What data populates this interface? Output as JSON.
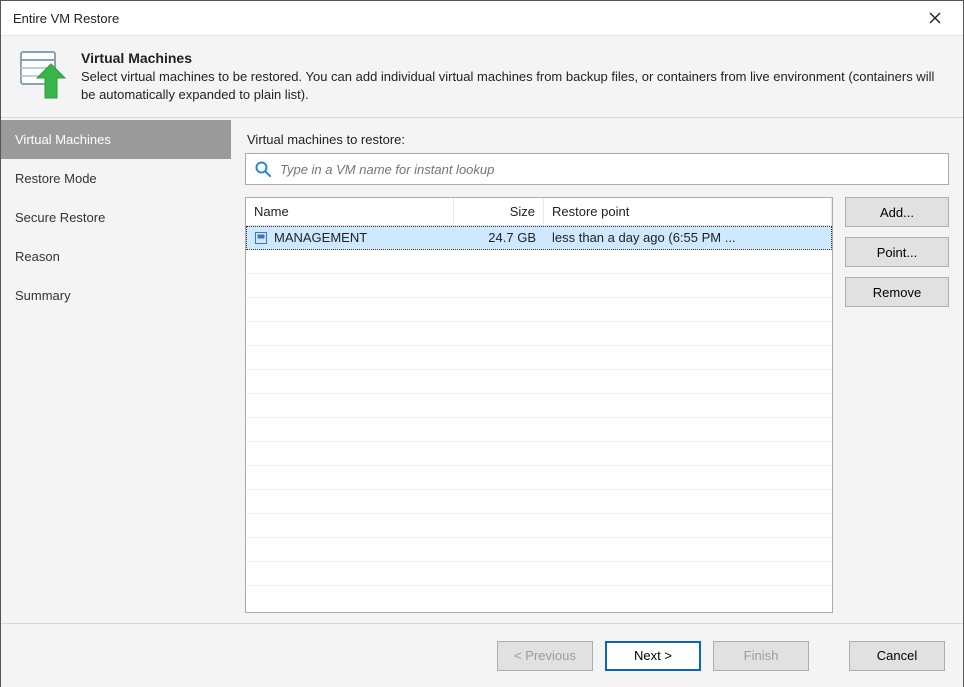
{
  "window": {
    "title": "Entire VM Restore"
  },
  "header": {
    "title": "Virtual Machines",
    "description": "Select virtual machines to be restored. You  can add individual virtual machines from backup files, or containers from live environment (containers will be automatically expanded to plain list)."
  },
  "sidenav": {
    "items": [
      {
        "label": "Virtual Machines",
        "active": true
      },
      {
        "label": "Restore Mode",
        "active": false
      },
      {
        "label": "Secure Restore",
        "active": false
      },
      {
        "label": "Reason",
        "active": false
      },
      {
        "label": "Summary",
        "active": false
      }
    ]
  },
  "main": {
    "list_label": "Virtual machines to restore:",
    "search_placeholder": "Type in a VM name for instant lookup",
    "columns": {
      "name": "Name",
      "size": "Size",
      "point": "Restore point"
    },
    "rows": [
      {
        "name": "MANAGEMENT",
        "size": "24.7 GB",
        "point": "less than a day ago (6:55 PM ...",
        "selected": true
      }
    ],
    "buttons": {
      "add": "Add...",
      "point": "Point...",
      "remove": "Remove"
    }
  },
  "footer": {
    "previous": "< Previous",
    "next": "Next >",
    "finish": "Finish",
    "cancel": "Cancel"
  }
}
